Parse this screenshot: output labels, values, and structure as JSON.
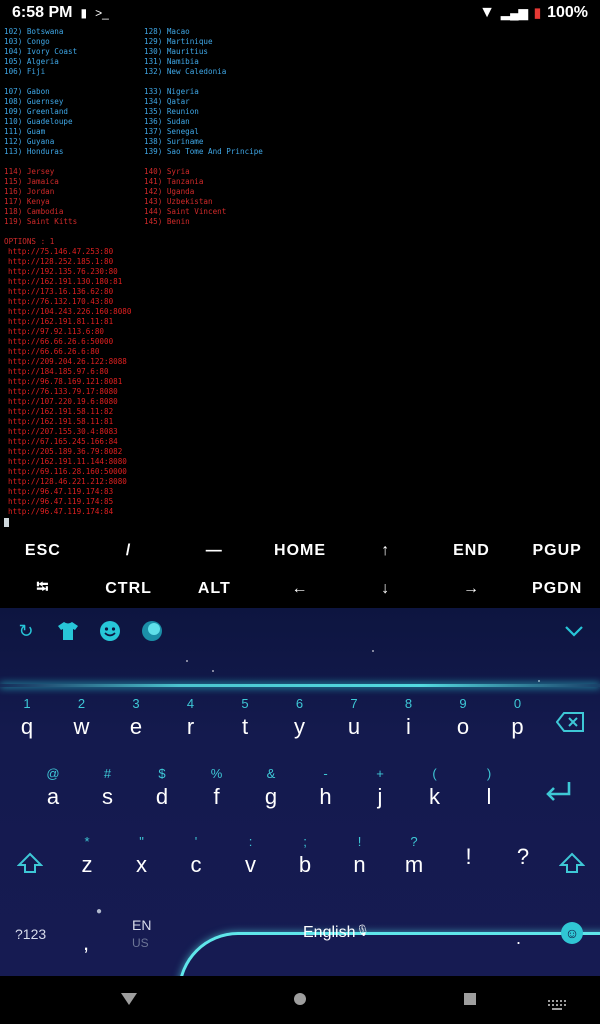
{
  "status": {
    "time": "6:58 PM",
    "battery": "100%",
    "icons": [
      "battery-icon",
      "terminal-icon",
      "wifi-icon",
      "signal-icon",
      "battery-charging-icon"
    ]
  },
  "terminal": {
    "groups": [
      {
        "color": "blue",
        "left": [
          "102) Botswana",
          "103) Congo",
          "104) Ivory Coast",
          "105) Algeria",
          "106) Fiji"
        ],
        "right": [
          "128) Macao",
          "129) Martinique",
          "130) Mauritius",
          "131) Namibia",
          "132) New Caledonia"
        ]
      },
      {
        "color": "blue",
        "left": [
          "107) Gabon",
          "108) Guernsey",
          "109) Greenland",
          "110) Guadeloupe",
          "111) Guam",
          "112) Guyana",
          "113) Honduras"
        ],
        "right": [
          "133) Nigeria",
          "134) Qatar",
          "135) Reunion",
          "136) Sudan",
          "137) Senegal",
          "138) Suriname",
          "139) Sao Tome And Principe"
        ]
      },
      {
        "color": "red",
        "left": [
          "114) Jersey",
          "115) Jamaica",
          "116) Jordan",
          "117) Kenya",
          "118) Cambodia",
          "119) Saint Kitts"
        ],
        "right": [
          "140) Syria",
          "141) Tanzania",
          "142) Uganda",
          "143) Uzbekistan",
          "144) Saint Vincent",
          "145) Benin"
        ]
      }
    ],
    "options_title": "OPTIONS : 1",
    "urls": [
      "http://75.146.47.253:80",
      "http://128.252.185.1:80",
      "http://192.135.76.230:80",
      "http://162.191.130.180:81",
      "http://173.16.136.62:80",
      "http://76.132.170.43:80",
      "http://104.243.226.160:8080",
      "http://162.191.81.11:81",
      "http://97.92.113.6:80",
      "http://66.66.26.6:50000",
      "http://66.66.26.6:80",
      "http://209.204.26.122:8088",
      "http://184.185.97.6:80",
      "http://96.78.169.121:8081",
      "http://76.133.79.17:8080",
      "http://107.220.19.6:8080",
      "http://162.191.58.11:82",
      "http://162.191.58.11:81",
      "http://207.155.30.4:8083",
      "http://67.165.245.166:84",
      "http://205.189.36.79:8082",
      "http://162.191.11.144:8080",
      "http://69.116.28.160:50000",
      "http://128.46.221.212:8080",
      "http://96.47.119.174:83",
      "http://96.47.119.174:85",
      "http://96.47.119.174:84"
    ]
  },
  "extra_keys": {
    "row1": [
      "ESC",
      "/",
      "―",
      "HOME",
      "↑",
      "END",
      "PGUP"
    ],
    "row2": [
      "⭾",
      "CTRL",
      "ALT",
      "←",
      "↓",
      "→",
      "PGDN"
    ]
  },
  "keyboard": {
    "toolbar_icons": [
      "swipe-icon",
      "theme-shirt-icon",
      "emoji-icon",
      "sticker-ball-icon"
    ],
    "rows": [
      [
        {
          "hint": "1",
          "key": "q"
        },
        {
          "hint": "2",
          "key": "w"
        },
        {
          "hint": "3",
          "key": "e"
        },
        {
          "hint": "4",
          "key": "r"
        },
        {
          "hint": "5",
          "key": "t"
        },
        {
          "hint": "6",
          "key": "y"
        },
        {
          "hint": "7",
          "key": "u"
        },
        {
          "hint": "8",
          "key": "i"
        },
        {
          "hint": "9",
          "key": "o"
        },
        {
          "hint": "0",
          "key": "p"
        }
      ],
      [
        {
          "hint": "@",
          "key": "a"
        },
        {
          "hint": "#",
          "key": "s"
        },
        {
          "hint": "$",
          "key": "d"
        },
        {
          "hint": "%",
          "key": "f"
        },
        {
          "hint": "&",
          "key": "g"
        },
        {
          "hint": "-",
          "key": "h"
        },
        {
          "hint": "+",
          "key": "j"
        },
        {
          "hint": "(",
          "key": "k"
        },
        {
          "hint": ")",
          "key": "l"
        }
      ],
      [
        {
          "hint": "*",
          "key": "z"
        },
        {
          "hint": "\"",
          "key": "x"
        },
        {
          "hint": "'",
          "key": "c"
        },
        {
          "hint": ":",
          "key": "v"
        },
        {
          "hint": ";",
          "key": "b"
        },
        {
          "hint": "!",
          "key": "n"
        },
        {
          "hint": "?",
          "key": "m"
        },
        {
          "hint": "",
          "key": "!"
        },
        {
          "hint": "",
          "key": "?"
        }
      ]
    ],
    "bottom": {
      "symbols": "?123",
      "comma": ",",
      "lang_main": "EN",
      "lang_sub": "US",
      "space_label": "English",
      "period": "."
    }
  },
  "accent_color": "#3ec8d6"
}
